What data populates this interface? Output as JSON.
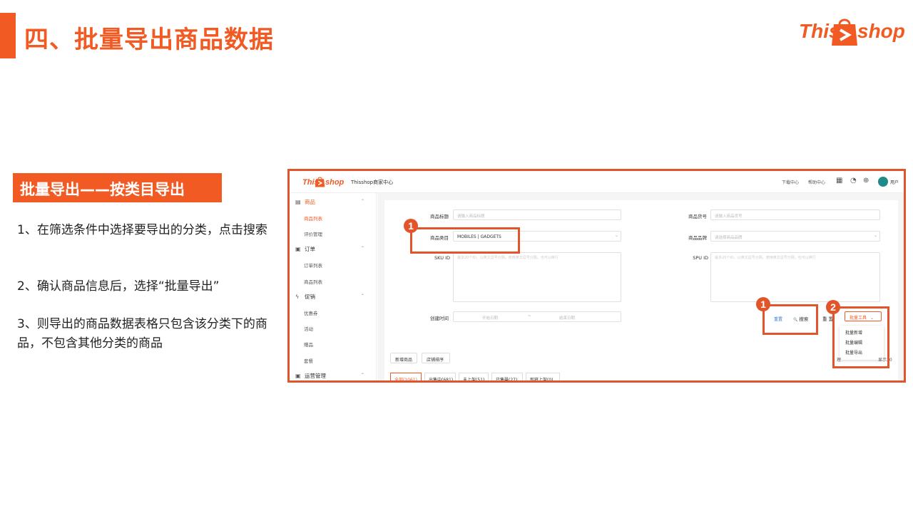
{
  "slide": {
    "title": "四、批量导出商品数据",
    "section_tag": "批量导出——按类目导出",
    "steps": [
      "1、在筛选条件中选择要导出的分类，点击搜索",
      "2、确认商品信息后，选择“批量导出”",
      "3、则导出的商品数据表格只包含该分类下的商品，不包含其他分类的商品"
    ]
  },
  "brand": {
    "left": "This",
    "right": "shop",
    "color": "#f15a22"
  },
  "app": {
    "logo_left": "This",
    "logo_right": "shop",
    "center_title": "Thisshop商家中心",
    "top_links": [
      "下载中心",
      "帮助中心"
    ],
    "user": "用户",
    "top_icons": [
      "grid-icon",
      "bell-icon",
      "globe-icon"
    ]
  },
  "sidebar": {
    "groups": [
      {
        "label": "商品",
        "icon": "▤",
        "items": [
          "商品列表",
          "评价管理"
        ]
      },
      {
        "label": "订单",
        "icon": "▣",
        "items": [
          "订单列表",
          "商品列表"
        ]
      },
      {
        "label": "促销",
        "icon": "ϟ",
        "items": [
          "优惠券",
          "活动",
          "赠品",
          "套餐"
        ]
      },
      {
        "label": "运营管理",
        "icon": "▣",
        "items": []
      }
    ]
  },
  "filters": {
    "title_label": "商品标题",
    "title_placeholder": "请输入商品标题",
    "code_label": "商品货号",
    "code_placeholder": "请输入商品货号",
    "category_label": "商品类目",
    "category_value": "MOBILES | GADGETS",
    "brand_label": "商品品牌",
    "brand_placeholder": "请选择商品品牌",
    "sku_label": "SKU ID",
    "sku_placeholder": "最多20个ID，以英文逗号分隔，使用英文逗号分隔，也可以换行",
    "spu_label": "SPU ID",
    "spu_placeholder": "最多20个ID，以英文逗号分隔，使用英文逗号分隔，也可以换行",
    "created_label": "创建时间",
    "start_placeholder": "开始日期",
    "date_separator": "~",
    "end_placeholder": "结束日期"
  },
  "buttons": {
    "reset_link": "重置",
    "search": "搜索",
    "search_icon": "🔍",
    "reset_fragment": "重 置",
    "batch_tools": "批量工具",
    "batch_chevron": "⌄",
    "batch_menu": [
      "批量新增",
      "批量编辑",
      "批量导出"
    ],
    "add_product": "新增商品",
    "store_sort": "店铺排序",
    "left_fragment": "理",
    "right_fragment": "显示30"
  },
  "tabs": [
    "全部(1061)",
    "出售中(681)",
    "未上架(51)",
    "已售罄(27)",
    "即将上架(0)"
  ],
  "annotations": {
    "badge_1": "1",
    "badge_2": "2",
    "color": "#e2542a"
  }
}
